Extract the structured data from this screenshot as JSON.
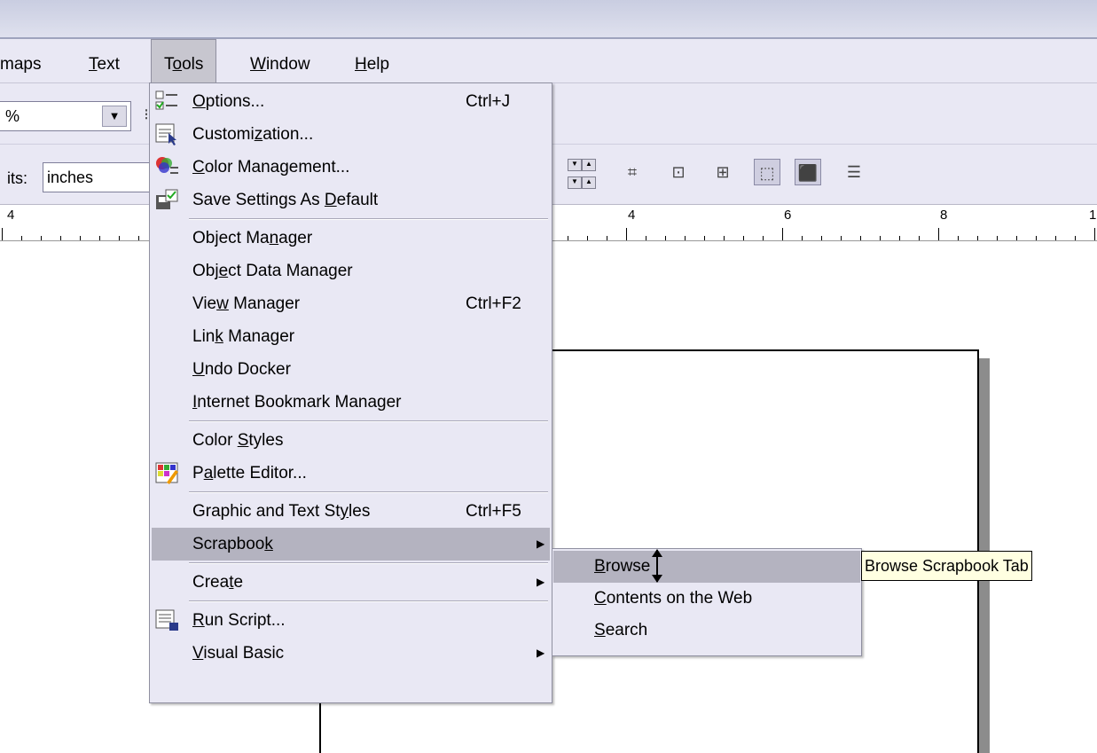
{
  "menubar": {
    "items": [
      {
        "label": "maps",
        "active": false
      },
      {
        "label": "Text",
        "mnemonic_index": 0,
        "active": false
      },
      {
        "label": "Tools",
        "mnemonic_index": 1,
        "active": true
      },
      {
        "label": "Window",
        "mnemonic_index": 0,
        "active": false
      },
      {
        "label": "Help",
        "mnemonic_index": 0,
        "active": false
      }
    ]
  },
  "toolbar": {
    "zoom_value": "%",
    "units_label": "its:",
    "units_value": "inches"
  },
  "ruler": {
    "labels": [
      "4",
      "4",
      "6",
      "8",
      "1"
    ]
  },
  "tools_menu": {
    "groups": [
      [
        {
          "label": "Options...",
          "mnemonic": "O",
          "shortcut": "Ctrl+J",
          "icon": "options-icon"
        },
        {
          "label": "Customization...",
          "mnemonic": "z",
          "shortcut": "",
          "icon": "customization-icon"
        },
        {
          "label": "Color Management...",
          "mnemonic": "C",
          "shortcut": "",
          "icon": "color-management-icon"
        },
        {
          "label": "Save Settings As Default",
          "mnemonic": "D",
          "shortcut": "",
          "icon": "save-settings-icon"
        }
      ],
      [
        {
          "label": "Object Manager",
          "mnemonic": "n",
          "shortcut": ""
        },
        {
          "label": "Object Data Manager",
          "mnemonic": "e",
          "shortcut": ""
        },
        {
          "label": "View Manager",
          "mnemonic": "w",
          "shortcut": "Ctrl+F2"
        },
        {
          "label": "Link Manager",
          "mnemonic": "k",
          "shortcut": ""
        },
        {
          "label": "Undo Docker",
          "mnemonic": "U",
          "shortcut": ""
        },
        {
          "label": "Internet Bookmark Manager",
          "mnemonic": "I",
          "shortcut": ""
        }
      ],
      [
        {
          "label": "Color Styles",
          "mnemonic": "S",
          "shortcut": ""
        },
        {
          "label": "Palette Editor...",
          "mnemonic": "a",
          "shortcut": "",
          "icon": "palette-editor-icon"
        }
      ],
      [
        {
          "label": "Graphic and Text Styles",
          "mnemonic": "y",
          "shortcut": "Ctrl+F5"
        },
        {
          "label": "Scrapbook",
          "mnemonic": "k",
          "shortcut": "",
          "submenu": true,
          "highlighted": true
        }
      ],
      [
        {
          "label": "Create",
          "mnemonic": "t",
          "shortcut": "",
          "submenu": true
        }
      ],
      [
        {
          "label": "Run Script...",
          "mnemonic": "R",
          "shortcut": "",
          "icon": "run-script-icon"
        },
        {
          "label": "Visual Basic",
          "mnemonic": "V",
          "shortcut": "",
          "submenu": true
        }
      ]
    ]
  },
  "scrapbook_submenu": {
    "items": [
      {
        "label": "Browse",
        "mnemonic": "B",
        "highlighted": true
      },
      {
        "label": "Contents on the Web",
        "mnemonic": "C"
      },
      {
        "label": "Search",
        "mnemonic": "S"
      }
    ]
  },
  "tooltip": {
    "text": "Browse Scrapbook Tab"
  },
  "colors": {
    "menu_bg": "#e9e8f4",
    "highlight": "#b4b3c0",
    "tooltip_bg": "#ffffe1"
  }
}
